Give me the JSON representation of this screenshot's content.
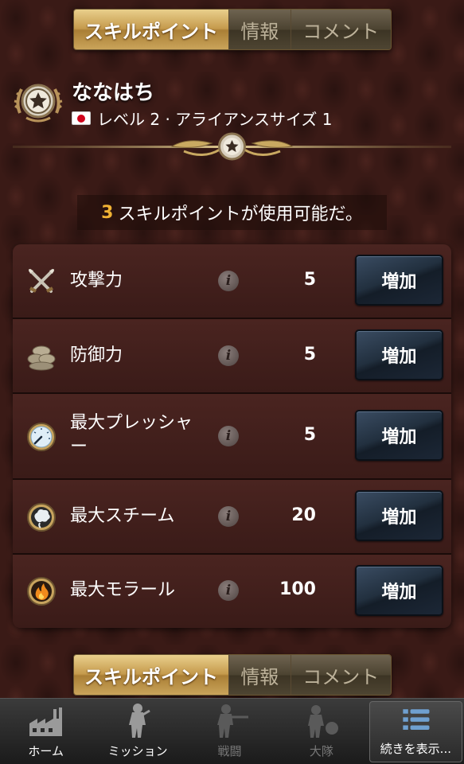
{
  "tabs": [
    {
      "label": "スキルポイント",
      "active": true
    },
    {
      "label": "情報",
      "active": false
    },
    {
      "label": "コメント",
      "active": false
    }
  ],
  "profile": {
    "name": "ななはち",
    "subtitle": "レベル 2 · アライアンスサイズ 1",
    "flag_icon": "japan-flag-icon",
    "badge_icon": "star-rank-badge-icon"
  },
  "available": {
    "count": "3",
    "text": "スキルポイントが使用可能だ。"
  },
  "skills": [
    {
      "name": "攻撃力",
      "value": "5",
      "button": "増加",
      "icon": "crossed-swords-icon"
    },
    {
      "name": "防御力",
      "value": "5",
      "button": "増加",
      "icon": "sandbags-icon"
    },
    {
      "name": "最大プレッシャー",
      "value": "5",
      "button": "増加",
      "icon": "pressure-gauge-icon"
    },
    {
      "name": "最大スチーム",
      "value": "20",
      "button": "増加",
      "icon": "steam-icon"
    },
    {
      "name": "最大モラール",
      "value": "100",
      "button": "増加",
      "icon": "fire-icon"
    }
  ],
  "info_glyph": "i",
  "nav": [
    {
      "label": "ホーム",
      "icon": "factory-icon",
      "enabled": true
    },
    {
      "label": "ミッション",
      "icon": "soldier-icon",
      "enabled": true
    },
    {
      "label": "戦闘",
      "icon": "rifleman-icon",
      "enabled": false
    },
    {
      "label": "大隊",
      "icon": "squad-icon",
      "enabled": false
    },
    {
      "label": "続きを表示...",
      "icon": "list-menu-icon",
      "enabled": true
    }
  ],
  "colors": {
    "accent_gold": "#f0b234",
    "button_blue": "#22303f",
    "panel_brown": "#4a2420"
  }
}
